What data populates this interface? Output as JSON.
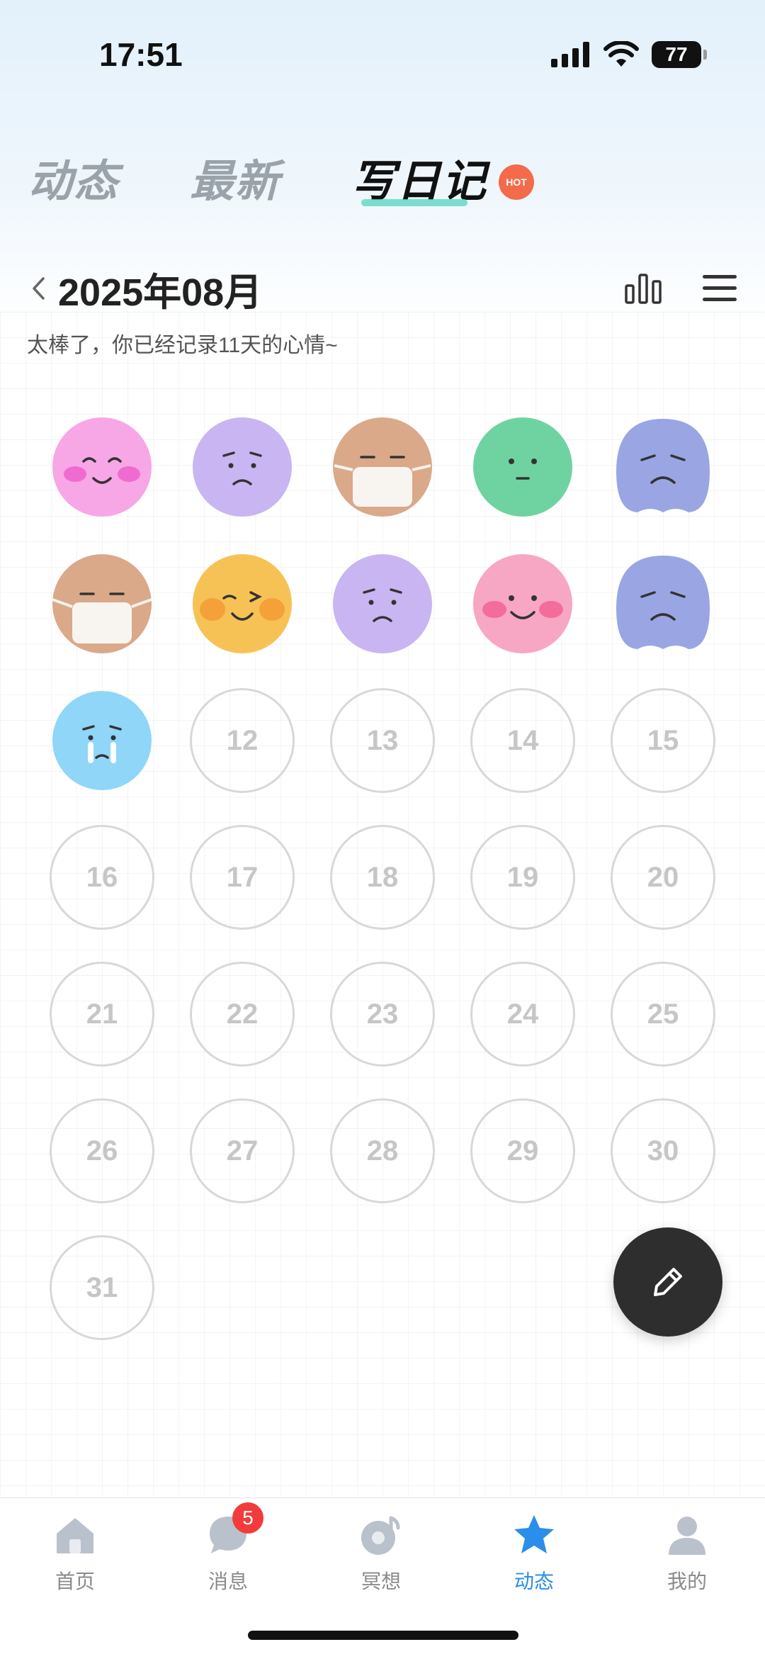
{
  "status_bar": {
    "time": "17:51",
    "battery": "77"
  },
  "top_tabs": [
    {
      "label": "动态",
      "active": false
    },
    {
      "label": "最新",
      "active": false
    },
    {
      "label": "写日记",
      "active": true
    }
  ],
  "hot_badge": "HOT",
  "header": {
    "month_title": "2025年08月",
    "subtitle": "太棒了，你已经记录11天的心情~"
  },
  "calendar": {
    "recorded_days": [
      {
        "day": 1,
        "mood": "happy-blush",
        "color": "#f7a6e6"
      },
      {
        "day": 2,
        "mood": "worried",
        "color": "#c8b5f2"
      },
      {
        "day": 3,
        "mood": "mask",
        "color": "#d9a98a"
      },
      {
        "day": 4,
        "mood": "neutral",
        "color": "#6fd3a1"
      },
      {
        "day": 5,
        "mood": "sad",
        "color": "#9aa6e3"
      },
      {
        "day": 6,
        "mood": "mask",
        "color": "#d9a98a"
      },
      {
        "day": 7,
        "mood": "wink",
        "color": "#f7c255"
      },
      {
        "day": 8,
        "mood": "worried",
        "color": "#c8b5f2"
      },
      {
        "day": 9,
        "mood": "smile-blush",
        "color": "#f7a6c4"
      },
      {
        "day": 10,
        "mood": "sad",
        "color": "#9aa6e3"
      },
      {
        "day": 11,
        "mood": "crying",
        "color": "#8fd6f8"
      }
    ],
    "empty_days": [
      "12",
      "13",
      "14",
      "15",
      "16",
      "17",
      "18",
      "19",
      "20",
      "21",
      "22",
      "23",
      "24",
      "25",
      "26",
      "27",
      "28",
      "29",
      "30",
      "31"
    ]
  },
  "bottom_nav": [
    {
      "label": "首页",
      "icon": "home-icon",
      "active": false
    },
    {
      "label": "消息",
      "icon": "message-icon",
      "active": false,
      "badge": "5"
    },
    {
      "label": "冥想",
      "icon": "meditation-icon",
      "active": false
    },
    {
      "label": "动态",
      "icon": "star-icon",
      "active": true
    },
    {
      "label": "我的",
      "icon": "profile-icon",
      "active": false
    }
  ],
  "colors": {
    "accent": "#2b8ee8",
    "badge": "#f23b3b",
    "fab": "#2e2e2e"
  }
}
